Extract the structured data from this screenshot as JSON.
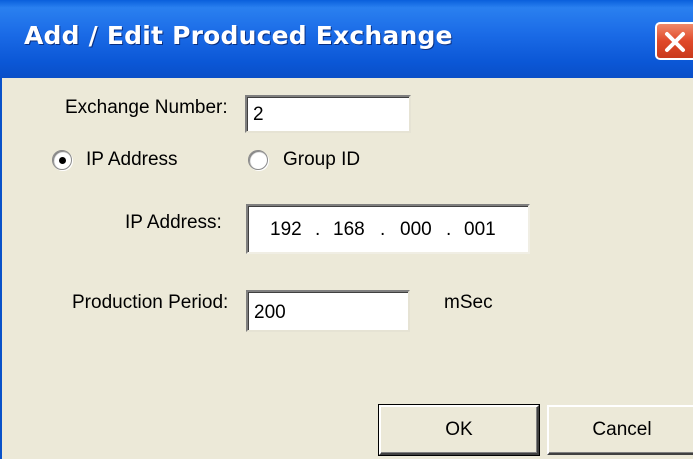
{
  "window": {
    "title": "Add / Edit Produced Exchange"
  },
  "form": {
    "exchange_number_label": "Exchange Number:",
    "exchange_number_value": "2",
    "radio_ip_label": "IP Address",
    "radio_group_label": "Group ID",
    "selected_mode": "IP Address",
    "ip_address_label": "IP Address:",
    "ip_octets": [
      "192",
      "168",
      "000",
      "001"
    ],
    "ip_separator": ".",
    "production_period_label": "Production Period:",
    "production_period_value": "200",
    "production_period_unit": "mSec"
  },
  "buttons": {
    "ok": "OK",
    "cancel": "Cancel"
  },
  "icons": {
    "close": "close-icon"
  },
  "colors": {
    "titlebar": "#0b57d6",
    "close": "#e0492a",
    "dialog_bg": "#ece9d8"
  }
}
